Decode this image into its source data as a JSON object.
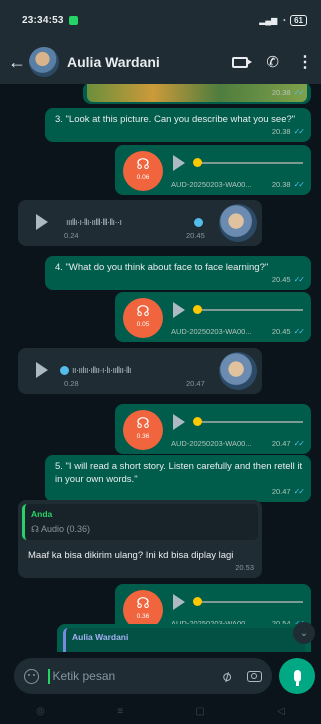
{
  "status_bar": {
    "time": "23:34:53",
    "battery": "61"
  },
  "header": {
    "contact_name": "Aulia Wardani"
  },
  "messages": {
    "image_top": {
      "time": "20.38"
    },
    "q3": {
      "text": "3. \"Look at this picture. Can you describe what you see?\"",
      "time": "20.38"
    },
    "audio_out_1": {
      "duration": "0.06",
      "filename": "AUD-20250203-WA00...",
      "time": "20.38"
    },
    "audio_in_1": {
      "duration": "0.24",
      "time": "20.45"
    },
    "q4": {
      "text": "4. \"What do you think about face to face learning?\"",
      "time": "20.45"
    },
    "audio_out_2": {
      "duration": "0.05",
      "filename": "AUD-20250203-WA00...",
      "time": "20.45"
    },
    "audio_in_2": {
      "duration": "0.28",
      "time": "20.47"
    },
    "audio_out_3": {
      "duration": "0.36",
      "filename": "AUD-20250203-WA00...",
      "time": "20.47"
    },
    "q5": {
      "text": "5. \"I will read a short story. Listen carefully and then retell it in your own words.\"",
      "time": "20.47"
    },
    "reply_in": {
      "quote_author": "Anda",
      "quote_text": "Audio (0.36)",
      "text": "Maaf ka bisa dikirim ulang? Ini kd bisa diplay lagi",
      "time": "20.53"
    },
    "audio_out_4": {
      "duration": "0.36",
      "filename": "AUD-20250203-WA00...",
      "time": "20.54"
    },
    "partial_reply": {
      "quote_author": "Aulia Wardani"
    }
  },
  "composer": {
    "placeholder": "Ketik pesan"
  },
  "colors": {
    "outgoing": "#005c4b",
    "incoming": "#1f2c34",
    "accent": "#25d366",
    "audio_badge": "#f0643e",
    "read_ticks": "#53bdeb"
  }
}
